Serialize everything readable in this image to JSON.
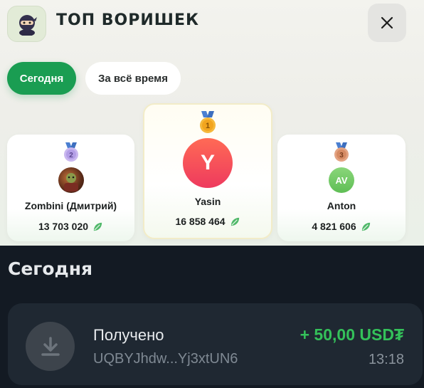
{
  "header": {
    "title": "ТОП ВОРИШЕК",
    "logo_icon": "ninja-icon",
    "close_icon": "close-icon"
  },
  "tabs": [
    {
      "label": "Сегодня",
      "active": true
    },
    {
      "label": "За всё время",
      "active": false
    }
  ],
  "leaderboard": [
    {
      "place": "2",
      "name": "Zombini (Дмитрий)",
      "score": "13 703 020",
      "avatar_type": "photo",
      "medal": "silver-medal-icon"
    },
    {
      "place": "1",
      "name": "Yasin",
      "score": "16 858 464",
      "avatar_letter": "Y",
      "avatar_color": "#f24a58",
      "medal": "gold-medal-icon"
    },
    {
      "place": "3",
      "name": "Anton",
      "score": "4 821 606",
      "avatar_letter": "AV",
      "avatar_color": "#7ccf6c",
      "medal": "bronze-medal-icon"
    }
  ],
  "section": {
    "title": "Сегодня"
  },
  "transactions": [
    {
      "label": "Получено",
      "address": "UQBYJhdw...Yj3xtUN6",
      "amount": "+ 50,00 USD₮",
      "time": "13:18",
      "icon": "download-icon"
    }
  ],
  "colors": {
    "accent_green": "#1a9d52",
    "amount_green": "#34c15a",
    "dark_bg": "#131a23"
  }
}
